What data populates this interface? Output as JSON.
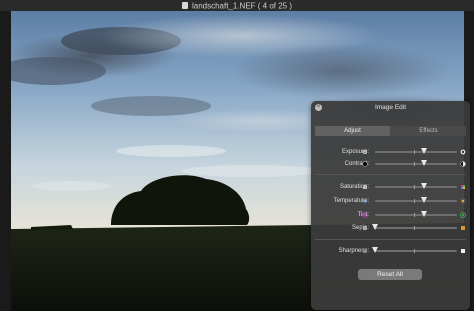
{
  "window": {
    "title": "landschaft_1.NEF ( 4 of 25 )"
  },
  "panel": {
    "title": "Image Edit",
    "tabs": [
      {
        "label": "Adjust",
        "active": true
      },
      {
        "label": "Effects",
        "active": false
      }
    ],
    "sliders": [
      {
        "label": "Exposure:",
        "icon_left": "sun-small-icon",
        "icon_right": "sun-large-icon",
        "value": 0.6,
        "group": 1
      },
      {
        "label": "Contrast:",
        "icon_left": "circle-dark-icon",
        "icon_right": "circle-half-icon",
        "value": 0.6,
        "group": 1
      },
      {
        "label": "Saturation:",
        "icon_left": "square-gray-icon",
        "icon_right": "square-color-icon",
        "value": 0.6,
        "group": 2
      },
      {
        "label": "Temperature:",
        "icon_left": "snowflake-icon",
        "icon_right": "sunburst-icon",
        "value": 0.6,
        "group": 2
      },
      {
        "label": "Tint:",
        "icon_left": "magenta-dot-icon",
        "icon_right": "green-dot-icon",
        "value": 0.6,
        "group": 2
      },
      {
        "label": "Sepia:",
        "icon_left": "square-gray-icon",
        "icon_right": "square-sepia-icon",
        "value": 0.0,
        "group": 2
      },
      {
        "label": "Sharpness:",
        "icon_left": "square-soft-icon",
        "icon_right": "square-sharp-icon",
        "value": 0.0,
        "group": 3
      }
    ],
    "reset_label": "Reset All"
  },
  "colors": {
    "panel_bg": "#3a3a3a",
    "tint_left": "#c04ac0",
    "tint_right": "#3fbf4a",
    "sepia_right": "#d79a2a"
  }
}
